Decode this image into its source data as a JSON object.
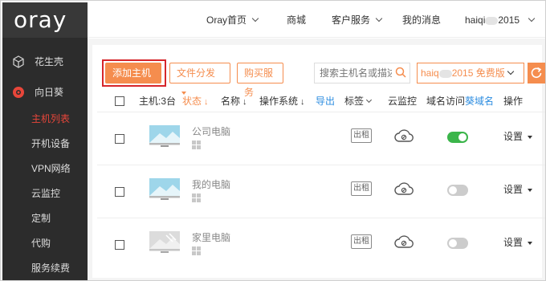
{
  "brand": {
    "logo_text": "oray"
  },
  "sidebar": {
    "top_items": [
      {
        "label": "花生壳",
        "icon": "cube-icon"
      },
      {
        "label": "向日葵",
        "icon": "sunflower-icon"
      }
    ],
    "items": [
      {
        "label": "主机列表",
        "active": true
      },
      {
        "label": "开机设备"
      },
      {
        "label": "VPN网络"
      },
      {
        "label": "云监控"
      },
      {
        "label": "定制"
      },
      {
        "label": "代购"
      },
      {
        "label": "服务续费"
      }
    ]
  },
  "topbar": {
    "home": "Oray首页",
    "mall": "商城",
    "service": "客户服务",
    "messages": "我的消息",
    "user_prefix": "haiqi",
    "user_suffix": "2015"
  },
  "toolbar": {
    "add_host": "添加主机",
    "file_dist": "文件分发",
    "buy_service": "购买服务",
    "search_placeholder": "搜索主机名或描述",
    "account_prefix": "haiq",
    "account_suffix": "2015 免费版"
  },
  "table": {
    "headers": {
      "host_count": "主机:3台",
      "status": "状态",
      "name": "名称",
      "os": "操作系统",
      "export": "导出",
      "tags": "标签",
      "cloud": "云监控",
      "domain": "域名访问",
      "kui_domain": "葵域名",
      "action": "操作"
    },
    "rows": [
      {
        "name": "公司电脑",
        "tag": "出租",
        "domain_on": true,
        "action": "设置",
        "monitor": "blue"
      },
      {
        "name": "我的电脑",
        "tag": "出租",
        "domain_on": false,
        "action": "设置",
        "monitor": "blue"
      },
      {
        "name": "家里电脑",
        "tag": "出租",
        "domain_on": false,
        "action": "设置",
        "monitor": "gray"
      }
    ]
  },
  "colors": {
    "accent": "#f58d4e",
    "active": "#e8463a",
    "toggle_on": "#3bb54a",
    "link": "#2d8de0"
  }
}
